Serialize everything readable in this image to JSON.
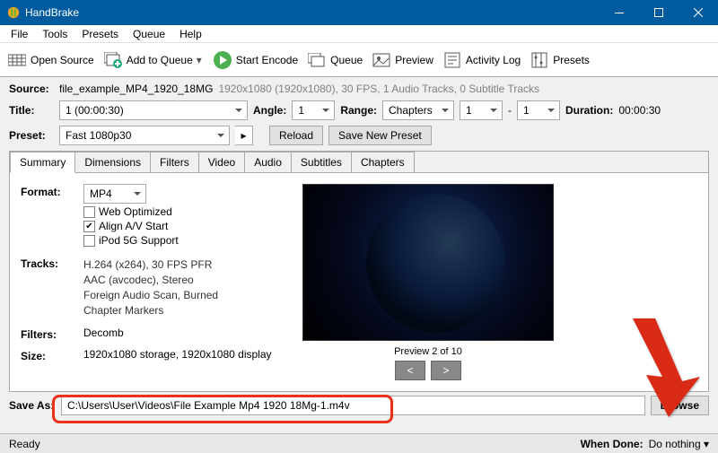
{
  "window": {
    "title": "HandBrake"
  },
  "menubar": [
    "File",
    "Tools",
    "Presets",
    "Queue",
    "Help"
  ],
  "toolbar": {
    "open_source": "Open Source",
    "add_to_queue": "Add to Queue",
    "start_encode": "Start Encode",
    "queue": "Queue",
    "preview": "Preview",
    "activity_log": "Activity Log",
    "presets": "Presets"
  },
  "source": {
    "label": "Source:",
    "filename": "file_example_MP4_1920_18MG",
    "info": "1920x1080 (1920x1080), 30 FPS, 1 Audio Tracks, 0 Subtitle Tracks"
  },
  "title_row": {
    "title_label": "Title:",
    "title_value": "1 (00:00:30)",
    "angle_label": "Angle:",
    "angle_value": "1",
    "range_label": "Range:",
    "range_type": "Chapters",
    "range_from": "1",
    "range_dash": "-",
    "range_to": "1",
    "duration_label": "Duration:",
    "duration_value": "00:00:30"
  },
  "preset_row": {
    "label": "Preset:",
    "value": "Fast 1080p30",
    "reload": "Reload",
    "save_new": "Save New Preset"
  },
  "tabs": [
    "Summary",
    "Dimensions",
    "Filters",
    "Video",
    "Audio",
    "Subtitles",
    "Chapters"
  ],
  "summary": {
    "format_label": "Format:",
    "format_value": "MP4",
    "web_optimized": "Web Optimized",
    "align_av": "Align A/V Start",
    "ipod_5g": "iPod 5G Support",
    "tracks_label": "Tracks:",
    "tracks": [
      "H.264 (x264), 30 FPS PFR",
      "AAC (avcodec), Stereo",
      "Foreign Audio Scan, Burned",
      "Chapter Markers"
    ],
    "filters_label": "Filters:",
    "filters_value": "Decomb",
    "size_label": "Size:",
    "size_value": "1920x1080 storage, 1920x1080 display",
    "preview_caption": "Preview 2 of 10",
    "prev": "<",
    "next": ">"
  },
  "save_as": {
    "label": "Save As:",
    "path": "C:\\Users\\User\\Videos\\File Example Mp4 1920 18Mg-1.m4v",
    "browse": "Browse"
  },
  "status": {
    "ready": "Ready",
    "when_done_label": "When Done:",
    "when_done_value": "Do nothing"
  }
}
